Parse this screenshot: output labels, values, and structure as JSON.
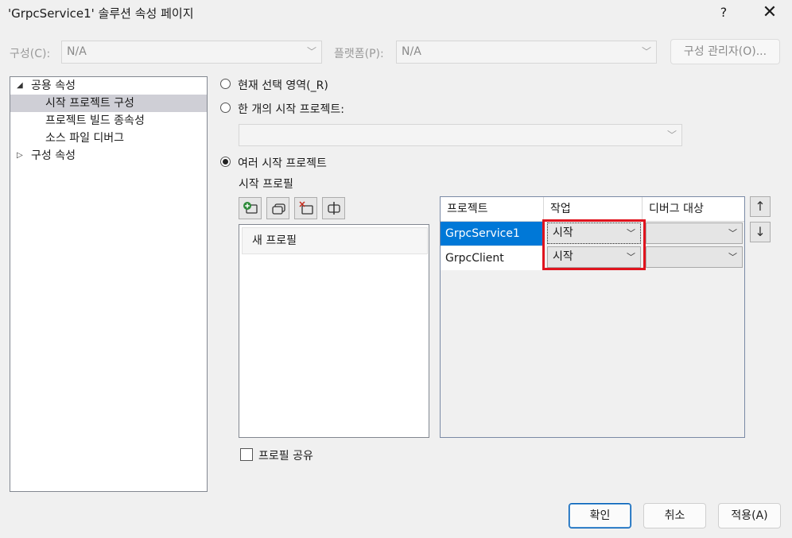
{
  "window": {
    "title": "'GrpcService1' 솔루션 속성 페이지",
    "help_glyph": "?",
    "close_glyph": "✕"
  },
  "config_bar": {
    "config_label": "구성(C):",
    "config_value": "N/A",
    "platform_label": "플랫폼(P):",
    "platform_value": "N/A",
    "manager_button": "구성 관리자(O)..."
  },
  "tree": {
    "items": [
      {
        "label": "공용 속성",
        "expanded": true
      },
      {
        "label": "시작 프로젝트 구성",
        "selected": true
      },
      {
        "label": "프로젝트 빌드 종속성"
      },
      {
        "label": "소스 파일 디버그"
      },
      {
        "label": "구성 속성",
        "expanded": false
      }
    ]
  },
  "startup": {
    "option_current": "현재 선택 영역(_R)",
    "option_single": "한 개의 시작 프로젝트:",
    "option_multiple": "여러 시작 프로젝트",
    "selected_option": "multiple",
    "profiles_label": "시작 프로필",
    "profiles": [
      "새 프로필"
    ],
    "share_profile_label": "프로필 공유"
  },
  "grid": {
    "headers": [
      "프로젝트",
      "작업",
      "디버그 대상"
    ],
    "rows": [
      {
        "project": "GrpcService1",
        "action": "시작",
        "target": ""
      },
      {
        "project": "GrpcClient",
        "action": "시작",
        "target": ""
      }
    ],
    "move_up": "↑",
    "move_down": "↓"
  },
  "footer": {
    "ok": "확인",
    "cancel": "취소",
    "apply": "적용(A)"
  },
  "colors": {
    "selection": "#0078d7",
    "highlight": "#e0141e",
    "tree_selection": "#cfcfd6"
  }
}
